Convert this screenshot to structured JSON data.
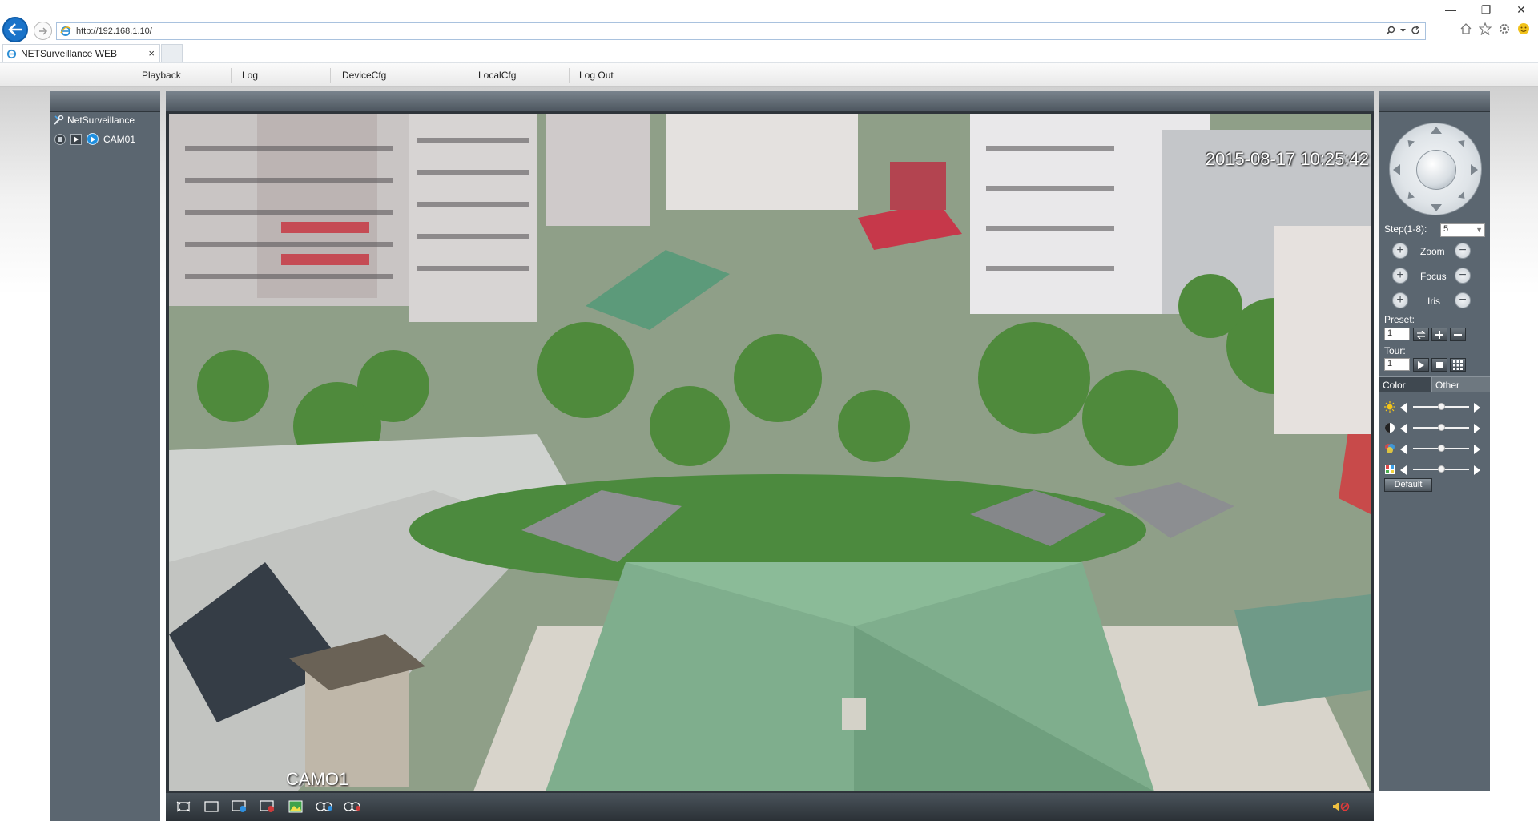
{
  "browser": {
    "url": "http://192.168.1.10/",
    "tab_title": "NETSurveillance WEB",
    "tab_close": "×"
  },
  "menu": [
    "Playback",
    "Log",
    "DeviceCfg",
    "LocalCfg",
    "Log Out"
  ],
  "tree": {
    "root": "NetSurveillance",
    "camera": "CAM01"
  },
  "video": {
    "timestamp": "2015-08-17 10:25:42",
    "channel_label": "CAMO1"
  },
  "ptz": {
    "step_label": "Step(1-8):",
    "step_value": "5",
    "zoom_label": "Zoom",
    "focus_label": "Focus",
    "iris_label": "Iris",
    "preset_label": "Preset:",
    "preset_value": "1",
    "tour_label": "Tour:",
    "tour_value": "1"
  },
  "image_settings": {
    "tab_color": "Color",
    "tab_other": "Other",
    "sliders": [
      {
        "icon": "brightness-icon",
        "value": 0.5
      },
      {
        "icon": "contrast-icon",
        "value": 0.5
      },
      {
        "icon": "saturation-icon",
        "value": 0.5
      },
      {
        "icon": "hue-icon",
        "value": 0.5
      }
    ],
    "default_label": "Default"
  },
  "colors": {
    "panel": "#5b6670",
    "accent": "#1e8fe0",
    "ie_blue": "#1a73c9"
  }
}
